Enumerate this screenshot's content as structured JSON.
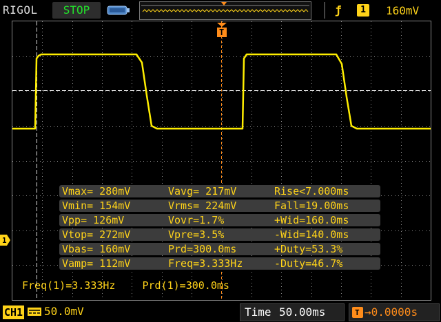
{
  "topbar": {
    "brand": "RIGOL",
    "status": "STOP",
    "trigger_source": "1",
    "trigger_level": "160mV",
    "trigger_edge_symbol": "ƒ"
  },
  "channel": {
    "tag": "CH1",
    "marker": "1",
    "scale": "50.0mV"
  },
  "timebase": {
    "label": "Time",
    "value": "50.00ms",
    "offset": "0.0000s"
  },
  "measurements": [
    [
      "Vmax= 280mV",
      "Vavg= 217mV",
      "Rise<7.000ms"
    ],
    [
      "Vmin= 154mV",
      "Vrms= 224mV",
      "Fall=19.00ms"
    ],
    [
      "Vpp= 126mV",
      "Vovr=1.7%",
      "+Wid=160.0ms"
    ],
    [
      "Vtop= 272mV",
      "Vpre=3.5%",
      "-Wid=140.0ms"
    ],
    [
      "Vbas= 160mV",
      "Prd=300.0ms",
      "+Duty=53.3%"
    ],
    [
      "Vamp= 112mV",
      "Freq=3.333Hz",
      "-Duty=46.7%"
    ]
  ],
  "footer": {
    "freq": "Freq(1)=3.333Hz",
    "prd": "Prd(1)=300.0ms"
  },
  "colors": {
    "trace": "#ffee00",
    "accent": "#ffd319",
    "status": "#22e22a",
    "grid": "#8a8a8a",
    "offset": "#ff8c1a"
  }
}
